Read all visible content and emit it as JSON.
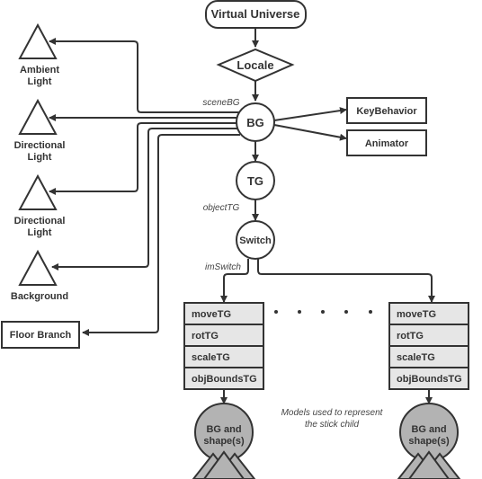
{
  "nodes": {
    "virtual_universe": "Virtual Universe",
    "locale": "Locale",
    "bg": "BG",
    "tg": "TG",
    "switch": "Switch",
    "key_behavior": "KeyBehavior",
    "animator": "Animator",
    "ambient_light": [
      "Ambient",
      "Light"
    ],
    "directional_light_1": [
      "Directional",
      "Light"
    ],
    "directional_light_2": [
      "Directional",
      "Light"
    ],
    "background": "Background",
    "floor_branch": "Floor Branch"
  },
  "edge_labels": {
    "scene_bg": "sceneBG",
    "object_tg": "objectTG",
    "im_switch": "imSwitch"
  },
  "stack_rows": [
    "moveTG",
    "rotTG",
    "scaleTG",
    "objBoundsTG"
  ],
  "model_node": [
    "BG and",
    "shape(s)"
  ],
  "caption": [
    "Models used to represent",
    "the stick child"
  ],
  "colors": {
    "stack_fill": "#e6e6e6",
    "model_fill": "#b3b3b3",
    "stroke": "#333333"
  }
}
